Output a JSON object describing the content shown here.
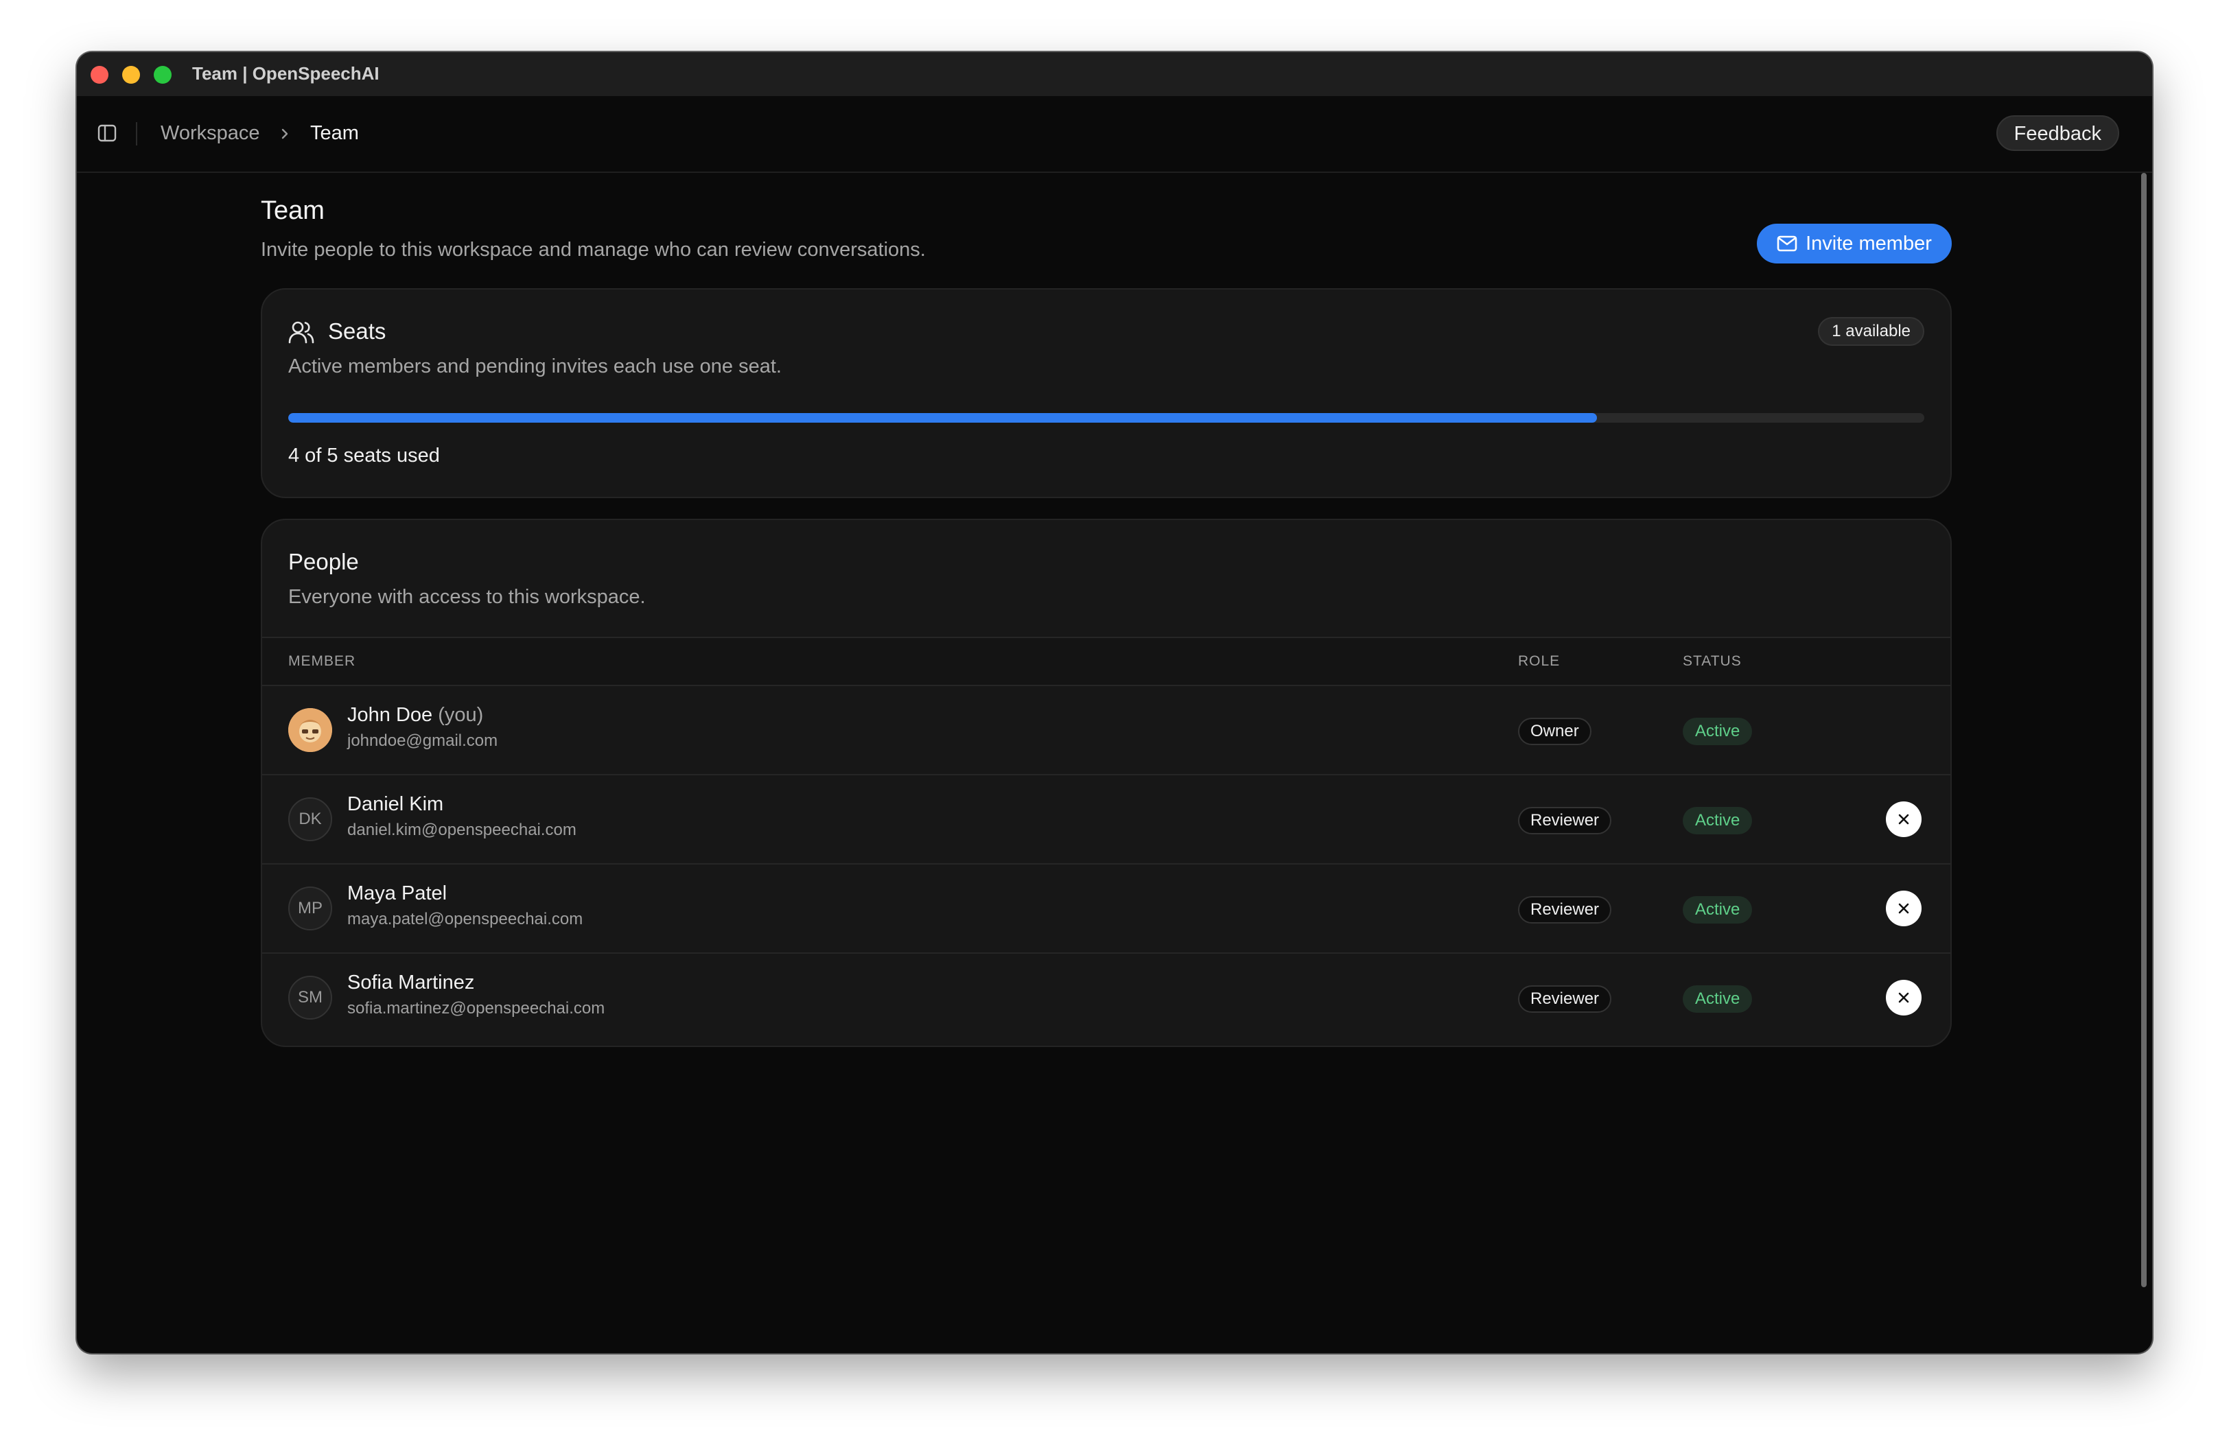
{
  "window": {
    "title": "Team | OpenSpeechAI"
  },
  "header": {
    "breadcrumb": [
      "Workspace",
      "Team"
    ],
    "feedback_label": "Feedback"
  },
  "page": {
    "title": "Team",
    "subtitle": "Invite people to this workspace and manage who can review conversations.",
    "invite_label": "Invite member"
  },
  "seats": {
    "title": "Seats",
    "available_badge": "1 available",
    "description": "Active members and pending invites each use one seat.",
    "used": 4,
    "total": 5,
    "usage_text": "4 of 5 seats used",
    "progress_fraction": 0.8
  },
  "people": {
    "title": "People",
    "description": "Everyone with access to this workspace.",
    "columns": {
      "member": "MEMBER",
      "role": "ROLE",
      "status": "STATUS"
    },
    "members": [
      {
        "name": "John Doe",
        "suffix": "(you)",
        "email": "johndoe@gmail.com",
        "initials": "",
        "avatar": "image",
        "role": "Owner",
        "status": "Active",
        "removable": false
      },
      {
        "name": "Daniel Kim",
        "suffix": "",
        "email": "daniel.kim@openspeechai.com",
        "initials": "DK",
        "avatar": "initials",
        "role": "Reviewer",
        "status": "Active",
        "removable": true
      },
      {
        "name": "Maya Patel",
        "suffix": "",
        "email": "maya.patel@openspeechai.com",
        "initials": "MP",
        "avatar": "initials",
        "role": "Reviewer",
        "status": "Active",
        "removable": true
      },
      {
        "name": "Sofia Martinez",
        "suffix": "",
        "email": "sofia.martinez@openspeechai.com",
        "initials": "SM",
        "avatar": "initials",
        "role": "Reviewer",
        "status": "Active",
        "removable": true
      }
    ]
  },
  "colors": {
    "accent": "#2f7cf0",
    "status_active": "#5fd08a",
    "background": "#0a0a0a",
    "card": "#171717"
  },
  "icons": {
    "sidebar_toggle": "sidebar-icon",
    "breadcrumb_separator": "chevron-right-icon",
    "invite": "mail-icon",
    "seats": "users-icon",
    "remove": "close-icon"
  }
}
